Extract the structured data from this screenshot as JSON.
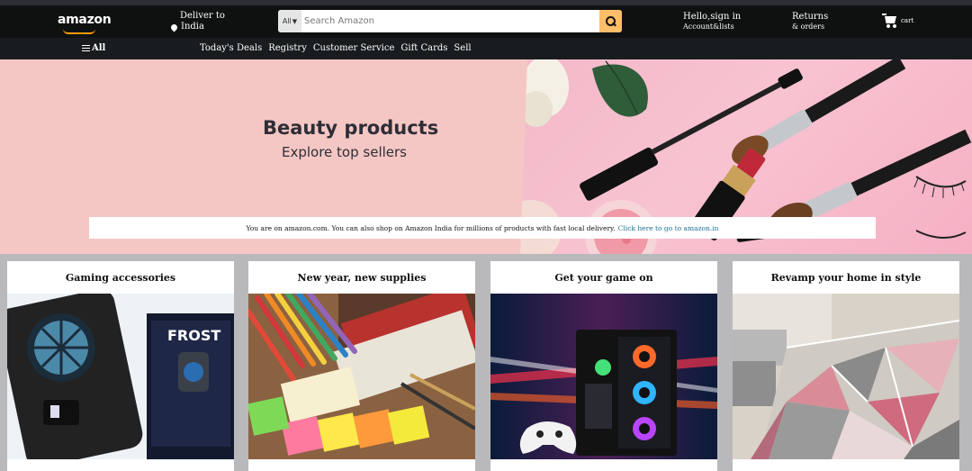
{
  "header": {
    "logo_text": "amazon",
    "deliver_line1": "Deliver to",
    "deliver_line2": "India",
    "search": {
      "category": "All",
      "placeholder": "Search Amazon"
    },
    "account_line1": "Hello,sign in",
    "account_line2": "Account&lists",
    "returns_line1": "Returns",
    "returns_line2": "& orders",
    "cart_label": "cart"
  },
  "subnav": {
    "all_label": "All",
    "links": [
      "Today's Deals",
      "Registry",
      "Customer Service",
      "Gift Cards",
      "Sell"
    ]
  },
  "hero": {
    "title": "Beauty products",
    "subtitle": "Explore top sellers"
  },
  "notice": {
    "text": "You are on amazon.com. You can also shop on Amazon India for millions of products with fast local delivery.",
    "link_text": "Click here to go to amazon.in"
  },
  "cards": [
    {
      "title": "Gaming accessories",
      "box_text": "FROST"
    },
    {
      "title": "New year, new supplies"
    },
    {
      "title": "Get your game on"
    },
    {
      "title": "Revamp your home in style"
    }
  ],
  "colors": {
    "nav_bg": "#0f1111",
    "search_button": "#febd69",
    "hero_bg": "#f5c7c4",
    "link": "#1f6f95"
  }
}
